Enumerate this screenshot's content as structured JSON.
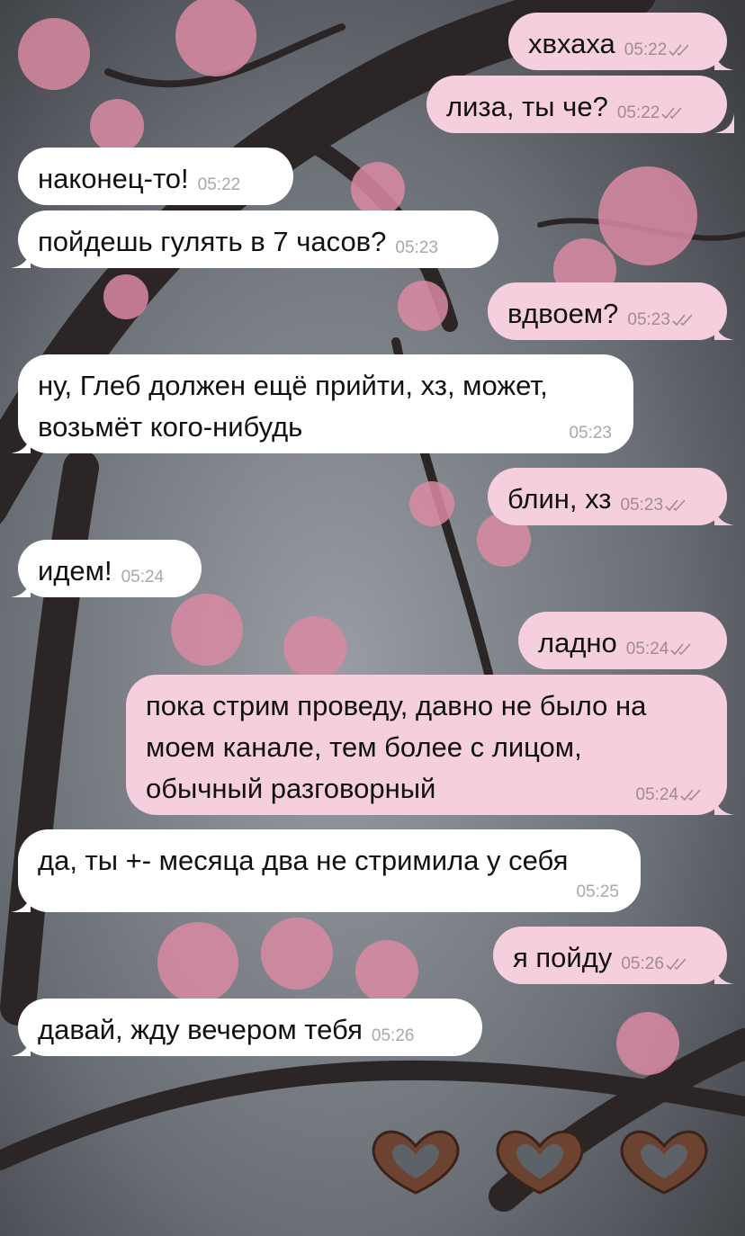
{
  "messages": [
    {
      "dir": "out",
      "text": "хвхаха",
      "time": "05:22"
    },
    {
      "dir": "out",
      "text": "лиза, ты че?",
      "time": "05:22"
    },
    {
      "dir": "in",
      "text": "наконец-то!",
      "time": "05:22"
    },
    {
      "dir": "in",
      "text": "пойдешь гулять в 7 часов?",
      "time": "05:23"
    },
    {
      "dir": "out",
      "text": "вдвоем?",
      "time": "05:23"
    },
    {
      "dir": "in",
      "text": "ну, Глеб должен ещё прийти, хз, может, возьмёт кого-нибудь",
      "time": "05:23"
    },
    {
      "dir": "out",
      "text": "блин, хз",
      "time": "05:23"
    },
    {
      "dir": "in",
      "text": "идем!",
      "time": "05:24"
    },
    {
      "dir": "out",
      "text": "ладно",
      "time": "05:24"
    },
    {
      "dir": "out",
      "text": "пока стрим проведу, давно не было на моем канале, тем более с лицом, обычный разговорный",
      "time": "05:24"
    },
    {
      "dir": "in",
      "text": "да, ты +- месяца два не стримила у себя",
      "time": "05:25"
    },
    {
      "dir": "out",
      "text": "я пойду",
      "time": "05:26"
    },
    {
      "dir": "in",
      "text": "давай, жду вечером тебя",
      "time": "05:26"
    }
  ],
  "sticker": {
    "emoji": "🫶🏿🫶🏿🫶🏿",
    "icons": [
      "heart-hands-icon",
      "heart-hands-icon",
      "heart-hands-icon"
    ]
  },
  "colors": {
    "outgoing_bubble": "#f6cfdf",
    "incoming_bubble": "#ffffff",
    "read_check": "#a08a93"
  },
  "status_icons": {
    "read": "double-check-icon"
  }
}
